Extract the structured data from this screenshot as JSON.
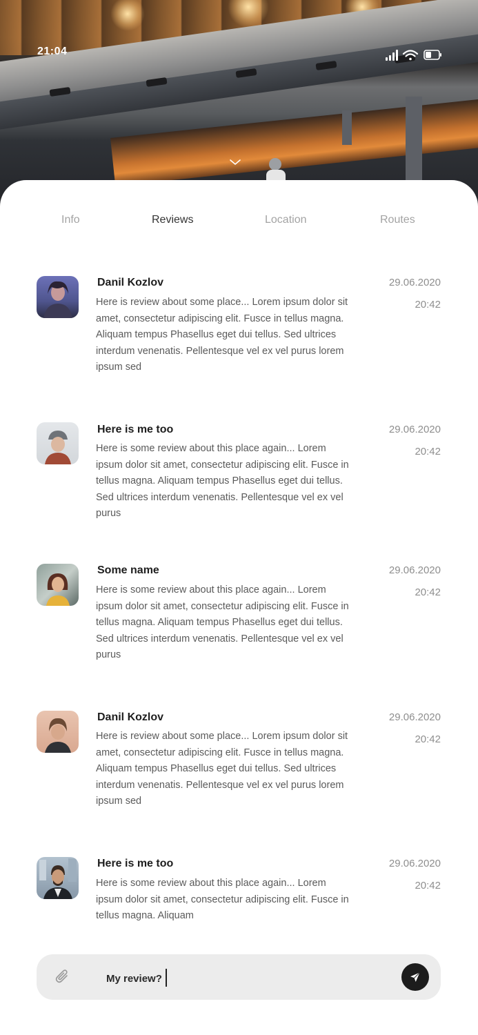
{
  "status_bar": {
    "time": "21:04"
  },
  "tabs": [
    {
      "label": "Info",
      "active": false
    },
    {
      "label": "Reviews",
      "active": true
    },
    {
      "label": "Location",
      "active": false
    },
    {
      "label": "Routes",
      "active": false
    }
  ],
  "reviews": [
    {
      "name": "Danil Kozlov",
      "text": "Here is review about some place... Lorem ipsum dolor sit amet, consectetur adipiscing elit. Fusce in tellus magna. Aliquam tempus Phasellus eget dui tellus. Sed ultrices interdum venenatis. Pellentesque vel ex vel purus lorem ipsum sed",
      "date": "29.06.2020",
      "time": "20:42"
    },
    {
      "name": "Here is me too",
      "text": "Here is some review about this place again... Lorem ipsum dolor sit amet, consectetur adipiscing elit. Fusce in tellus magna. Aliquam tempus Phasellus eget dui tellus. Sed ultrices interdum venenatis. Pellentesque vel ex vel purus",
      "date": "29.06.2020",
      "time": "20:42"
    },
    {
      "name": "Some name",
      "text": "Here is some review about this place again... Lorem ipsum dolor sit amet, consectetur adipiscing elit. Fusce in tellus magna. Aliquam tempus Phasellus eget dui tellus. Sed ultrices interdum venenatis. Pellentesque vel ex vel purus",
      "date": "29.06.2020",
      "time": "20:42"
    },
    {
      "name": "Danil Kozlov",
      "text": "Here is review about some place... Lorem ipsum dolor sit amet, consectetur adipiscing elit. Fusce in tellus magna. Aliquam tempus Phasellus eget dui tellus. Sed ultrices interdum venenatis. Pellentesque vel ex vel purus lorem ipsum sed",
      "date": "29.06.2020",
      "time": "20:42"
    },
    {
      "name": "Here is me too",
      "text": "Here is some review about this place again... Lorem ipsum dolor sit amet, consectetur adipiscing elit. Fusce in tellus magna. Aliquam",
      "date": "29.06.2020",
      "time": "20:42"
    }
  ],
  "composer": {
    "value": "My review?",
    "attach_icon": "paperclip-icon",
    "send_icon": "send-icon"
  },
  "icons": {
    "signal": "signal-icon",
    "wifi": "wifi-icon",
    "battery": "battery-icon",
    "chevron": "chevron-down-icon"
  },
  "colors": {
    "active_tab": "#333333",
    "inactive_tab": "#a3a3a3",
    "send_button": "#1c1c1c",
    "composer_bg": "#ececec"
  }
}
